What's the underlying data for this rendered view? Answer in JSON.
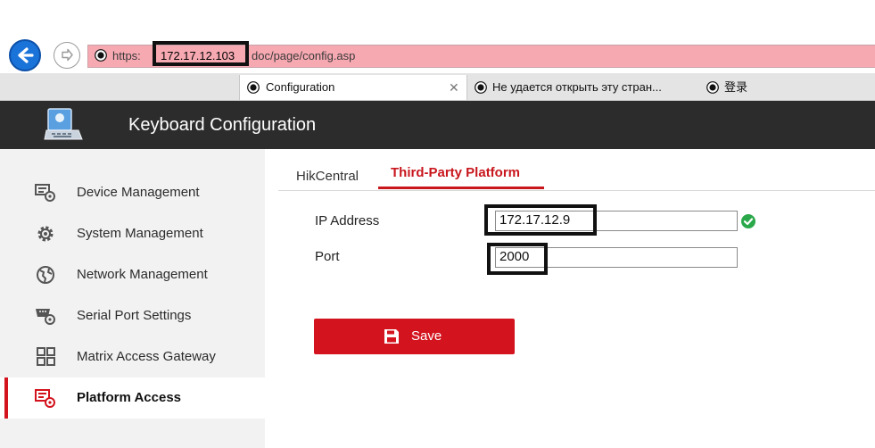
{
  "browser": {
    "address": {
      "scheme": "https:",
      "host": "172.17.12.103",
      "path": "doc/page/config.asp"
    },
    "tabs": [
      {
        "label": "Configuration",
        "active": true
      },
      {
        "label": "Не удается открыть эту стран...",
        "active": false
      },
      {
        "label": "登录",
        "active": false
      }
    ]
  },
  "app": {
    "title": "Keyboard Configuration",
    "accent_color": "#d3131d",
    "header_color": "#2c2c2c"
  },
  "sidebar": {
    "items": [
      {
        "label": "Device Management",
        "icon": "device-management-icon"
      },
      {
        "label": "System Management",
        "icon": "gear-icon"
      },
      {
        "label": "Network Management",
        "icon": "globe-icon"
      },
      {
        "label": "Serial Port Settings",
        "icon": "serial-port-icon"
      },
      {
        "label": "Matrix Access Gateway",
        "icon": "grid-icon"
      },
      {
        "label": "Platform Access",
        "icon": "platform-access-icon",
        "active": true
      }
    ]
  },
  "main": {
    "tabs": [
      {
        "label": "HikCentral",
        "active": false
      },
      {
        "label": "Third-Party Platform",
        "active": true
      }
    ],
    "form": {
      "ip_label": "IP Address",
      "ip_value": "172.17.12.9",
      "ip_valid": true,
      "port_label": "Port",
      "port_value": "2000"
    },
    "save_label": "Save"
  }
}
